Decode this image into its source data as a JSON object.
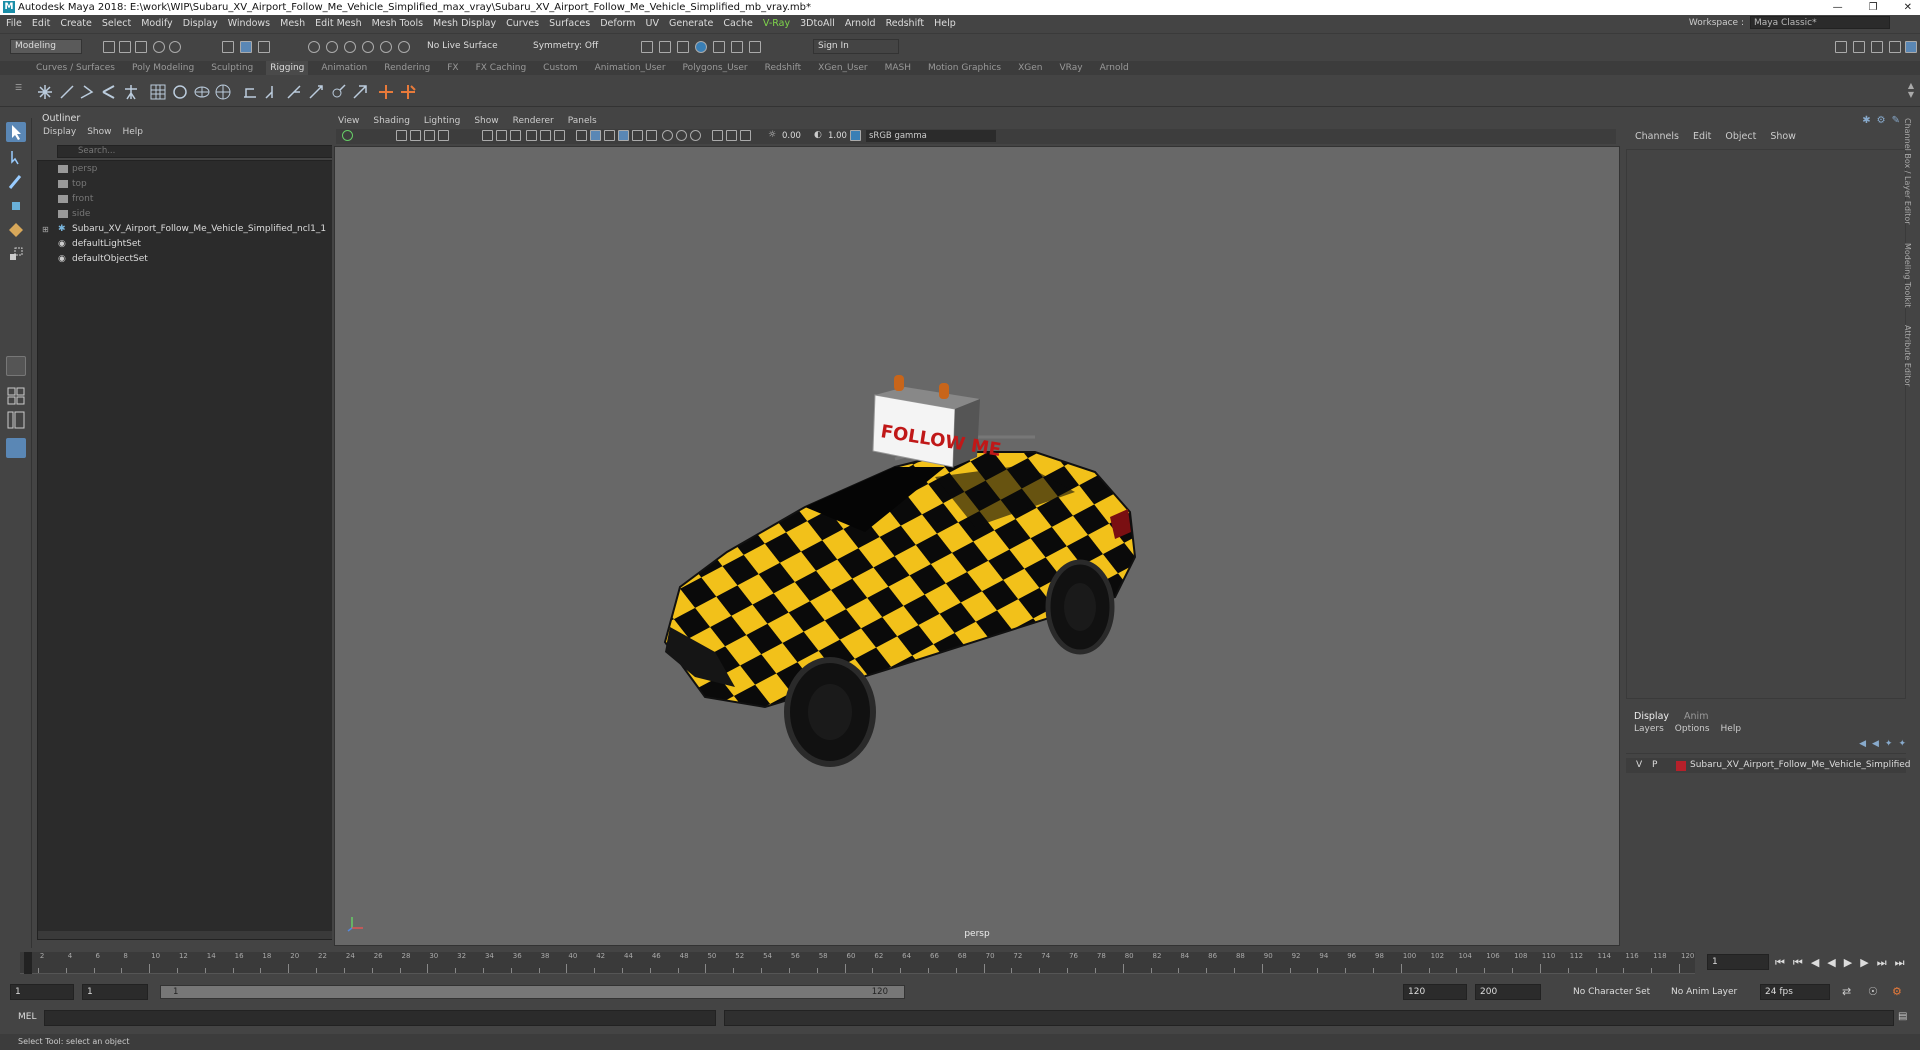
{
  "title": "Autodesk Maya 2018: E:\\work\\WIP\\Subaru_XV_Airport_Follow_Me_Vehicle_Simplified_max_vray\\Subaru_XV_Airport_Follow_Me_Vehicle_Simplified_mb_vray.mb*",
  "menus": [
    "File",
    "Edit",
    "Create",
    "Select",
    "Modify",
    "Display",
    "Windows",
    "Mesh",
    "Edit Mesh",
    "Mesh Tools",
    "Mesh Display",
    "Curves",
    "Surfaces",
    "Deform",
    "UV",
    "Generate",
    "Cache",
    "V-Ray",
    "3DtoAll",
    "Arnold",
    "Redshift",
    "Help"
  ],
  "workspace": {
    "label": "Workspace :",
    "value": "Maya Classic*"
  },
  "statusline": {
    "mode": "Modeling",
    "live_surface": "No Live Surface",
    "symmetry": "Symmetry: Off",
    "sign_in": "Sign In"
  },
  "shelf_tabs": [
    "Curves / Surfaces",
    "Poly Modeling",
    "Sculpting",
    "Rigging",
    "Animation",
    "Rendering",
    "FX",
    "FX Caching",
    "Custom",
    "Animation_User",
    "Polygons_User",
    "Redshift",
    "XGen_User",
    "MASH",
    "Motion Graphics",
    "XGen",
    "VRay",
    "Arnold"
  ],
  "shelf_active": "Rigging",
  "outliner": {
    "title": "Outliner",
    "menu": [
      "Display",
      "Show",
      "Help"
    ],
    "search_placeholder": "Search...",
    "items": [
      {
        "label": "persp",
        "dim": true
      },
      {
        "label": "top",
        "dim": true
      },
      {
        "label": "front",
        "dim": true
      },
      {
        "label": "side",
        "dim": true
      },
      {
        "label": "Subaru_XV_Airport_Follow_Me_Vehicle_Simplified_ncl1_1",
        "dim": false
      },
      {
        "label": "defaultLightSet",
        "dim": false
      },
      {
        "label": "defaultObjectSet",
        "dim": false
      }
    ]
  },
  "viewport": {
    "menu": [
      "View",
      "Shading",
      "Lighting",
      "Show",
      "Renderer",
      "Panels"
    ],
    "exposure": "0.00",
    "gamma": "1.00",
    "color_space": "sRGB gamma",
    "camera_label": "persp",
    "sign_text": "FOLLOW ME"
  },
  "channel_box": {
    "menu": [
      "Channels",
      "Edit",
      "Object",
      "Show"
    ],
    "layer_tabs": [
      "Display",
      "Anim"
    ],
    "layer_menu": [
      "Layers",
      "Options",
      "Help"
    ],
    "layer": {
      "v": "V",
      "p": "P",
      "name": "Subaru_XV_Airport_Follow_Me_Vehicle_Simplified",
      "color": "#b5202a"
    },
    "side_tabs": [
      "Channel Box / Layer Editor",
      "Modeling Toolkit",
      "Attribute Editor"
    ]
  },
  "timeline": {
    "ticks": [
      "1",
      "2",
      "4",
      "6",
      "8",
      "10",
      "12",
      "14",
      "16",
      "18",
      "20",
      "22",
      "24",
      "26",
      "28",
      "30",
      "32",
      "34",
      "36",
      "38",
      "40",
      "42",
      "44",
      "46",
      "48",
      "50",
      "52",
      "54",
      "56",
      "58",
      "60",
      "62",
      "64",
      "66",
      "68",
      "70",
      "72",
      "74",
      "76",
      "78",
      "80",
      "82",
      "84",
      "86",
      "88",
      "90",
      "92",
      "94",
      "96",
      "98",
      "100",
      "102",
      "104",
      "106",
      "108",
      "110",
      "112",
      "114",
      "116",
      "118",
      "120"
    ],
    "current_frame": "1"
  },
  "range": {
    "start": "1",
    "start2": "1",
    "slider_left": "1",
    "slider_right": "120",
    "end": "120",
    "end2": "200",
    "character_set": "No Character Set",
    "anim_layer": "No Anim Layer",
    "fps": "24 fps"
  },
  "cmdline": {
    "label": "MEL"
  },
  "help_line": "Select Tool: select an object"
}
